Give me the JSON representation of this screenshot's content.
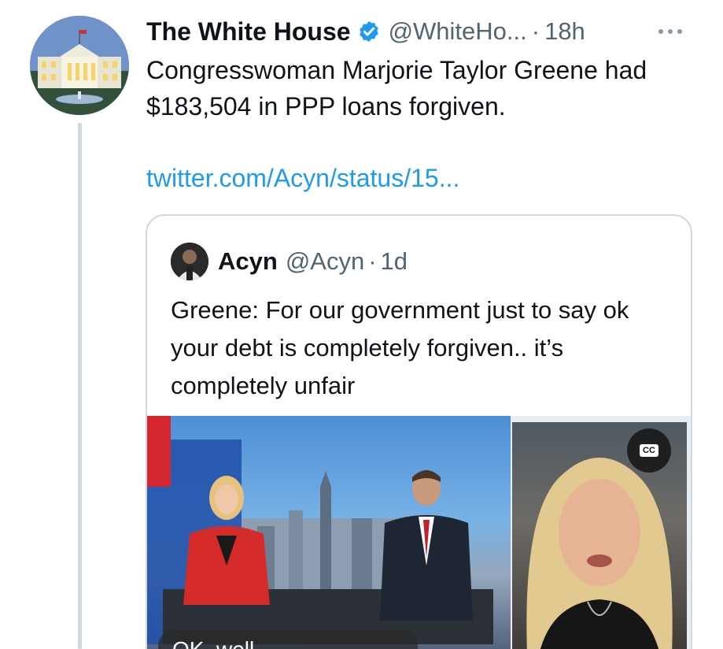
{
  "tweet": {
    "display_name": "The White House",
    "handle": "@WhiteHo...",
    "time": "18h",
    "text": "Congresswoman Marjorie Taylor Greene had $183,504 in PPP loans forgiven.",
    "link": "twitter.com/Acyn/status/15...",
    "verified_color": "#1d9bf0"
  },
  "quote": {
    "display_name": "Acyn",
    "handle": "@Acyn",
    "time": "1d",
    "text": "Greene: For our government just to say ok your debt is completely forgiven.. it’s completely unfair",
    "cc_label": "CC",
    "caption": "OK, well"
  },
  "icons": {
    "verified": "verified-badge-icon",
    "more": "more-options-icon",
    "cc": "closed-captions-icon"
  }
}
